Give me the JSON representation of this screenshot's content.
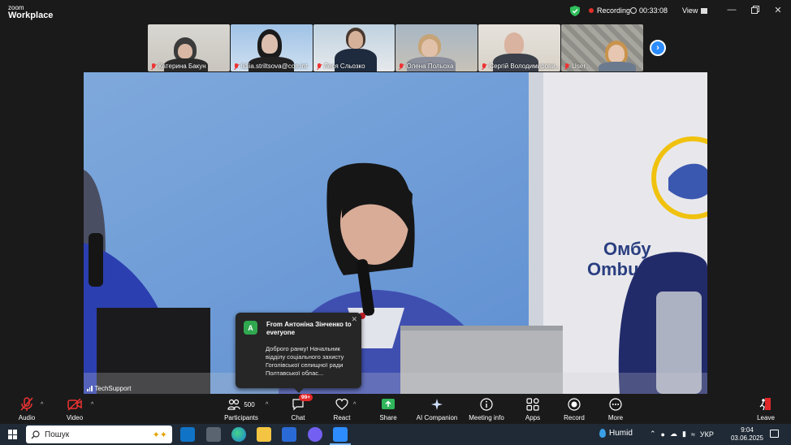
{
  "app": {
    "brand_small": "zoom",
    "brand_big": "Workplace",
    "recording_label": "Recording",
    "timer": "00:33:08",
    "view_label": "View",
    "window_controls": [
      "minimize",
      "restore",
      "close"
    ]
  },
  "thumbnails": [
    {
      "name": "Катерина Бакун",
      "muted": true
    },
    {
      "name": "lidiia.striltsova@coe.int",
      "muted": true
    },
    {
      "name": "Леся Сльозко",
      "muted": true
    },
    {
      "name": "Олена Польоха",
      "muted": true
    },
    {
      "name": "Сергій Володимирови...",
      "muted": true
    },
    {
      "name": "User",
      "muted": true
    }
  ],
  "main_video": {
    "name": "TechSupport"
  },
  "chat_toast": {
    "avatar_letter": "A",
    "from": "From Антоніна Зінченко to everyone",
    "message": "Доброго ранку! Начальник відділу соціального захисту Гоголівської селищної ради Полтавської облас..."
  },
  "toolbar": {
    "audio": "Audio",
    "video": "Video",
    "participants": "Participants",
    "participants_count": "500",
    "chat": "Chat",
    "chat_badge": "99+",
    "react": "React",
    "share": "Share",
    "ai_companion": "AI Companion",
    "meeting_info": "Meeting info",
    "apps": "Apps",
    "record": "Record",
    "more": "More",
    "leave": "Leave"
  },
  "taskbar": {
    "search_placeholder": "Пошук",
    "weather": "Humid",
    "language": "УКР",
    "time": "9:04",
    "date": "03.06.2025"
  },
  "colors": {
    "accent": "#2d8cff",
    "record_red": "#e0302a",
    "share_green": "#2fb55b",
    "shield_green": "#2fbf5b"
  }
}
